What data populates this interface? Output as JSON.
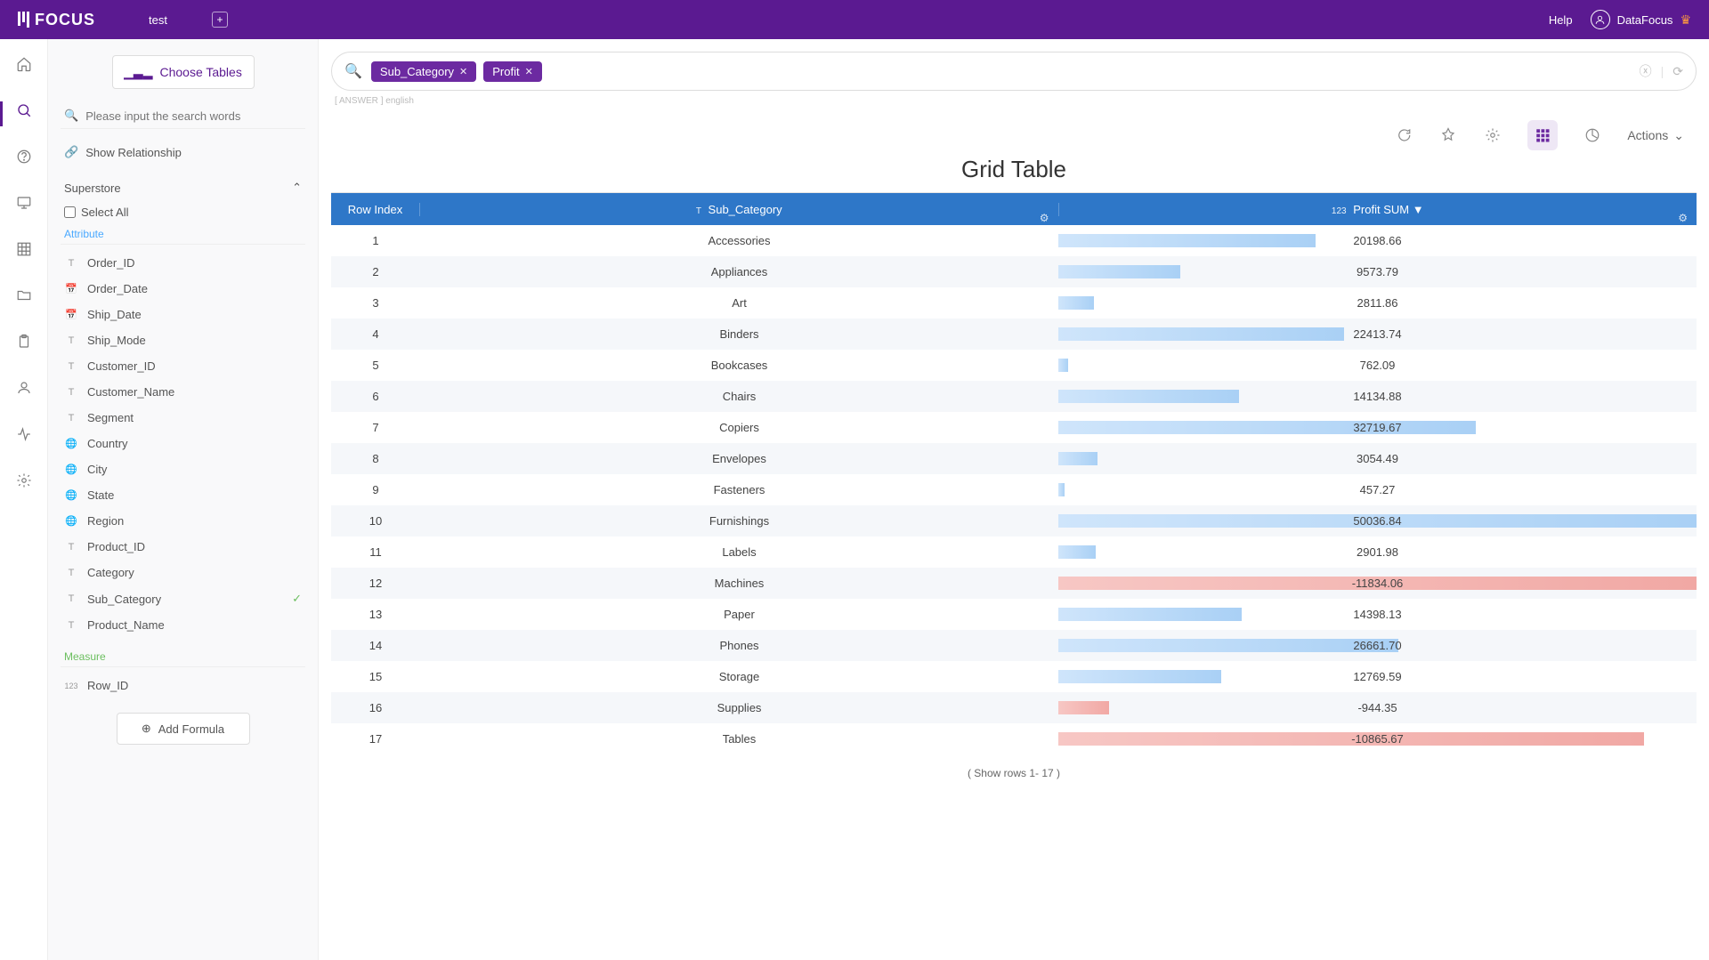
{
  "app": {
    "name": "FOCUS",
    "tab": "test"
  },
  "header": {
    "help": "Help",
    "user": "DataFocus"
  },
  "side": {
    "choose_tables": "Choose Tables",
    "search_placeholder": "Please input the search words",
    "show_relationship": "Show Relationship",
    "datasource": "Superstore",
    "select_all": "Select All",
    "attribute_label": "Attribute",
    "measure_label": "Measure",
    "add_formula": "Add Formula",
    "attributes": [
      {
        "type": "T",
        "name": "Order_ID"
      },
      {
        "type": "D",
        "name": "Order_Date"
      },
      {
        "type": "D",
        "name": "Ship_Date"
      },
      {
        "type": "T",
        "name": "Ship_Mode"
      },
      {
        "type": "T",
        "name": "Customer_ID"
      },
      {
        "type": "T",
        "name": "Customer_Name"
      },
      {
        "type": "T",
        "name": "Segment"
      },
      {
        "type": "G",
        "name": "Country"
      },
      {
        "type": "G",
        "name": "City"
      },
      {
        "type": "G",
        "name": "State"
      },
      {
        "type": "G",
        "name": "Region"
      },
      {
        "type": "T",
        "name": "Product_ID"
      },
      {
        "type": "T",
        "name": "Category"
      },
      {
        "type": "T",
        "name": "Sub_Category",
        "checked": true
      },
      {
        "type": "T",
        "name": "Product_Name"
      }
    ],
    "measures": [
      {
        "type": "123",
        "name": "Row_ID"
      }
    ]
  },
  "search": {
    "pills": [
      "Sub_Category",
      "Profit"
    ],
    "crumb_left": "ANSWER",
    "crumb_right": "english"
  },
  "toolbar": {
    "actions": "Actions"
  },
  "grid": {
    "title": "Grid Table",
    "col_rowidx": "Row Index",
    "col_sub": "Sub_Category",
    "col_profit": "Profit SUM",
    "footer": "( Show rows 1- 17 )",
    "rows": [
      {
        "idx": 1,
        "sub": "Accessories",
        "val": 20198.66
      },
      {
        "idx": 2,
        "sub": "Appliances",
        "val": 9573.79
      },
      {
        "idx": 3,
        "sub": "Art",
        "val": 2811.86
      },
      {
        "idx": 4,
        "sub": "Binders",
        "val": 22413.74
      },
      {
        "idx": 5,
        "sub": "Bookcases",
        "val": 762.09
      },
      {
        "idx": 6,
        "sub": "Chairs",
        "val": 14134.88
      },
      {
        "idx": 7,
        "sub": "Copiers",
        "val": 32719.67
      },
      {
        "idx": 8,
        "sub": "Envelopes",
        "val": 3054.49
      },
      {
        "idx": 9,
        "sub": "Fasteners",
        "val": 457.27
      },
      {
        "idx": 10,
        "sub": "Furnishings",
        "val": 50036.84
      },
      {
        "idx": 11,
        "sub": "Labels",
        "val": 2901.98
      },
      {
        "idx": 12,
        "sub": "Machines",
        "val": -11834.06
      },
      {
        "idx": 13,
        "sub": "Paper",
        "val": 14398.13
      },
      {
        "idx": 14,
        "sub": "Phones",
        "val": 26661.7
      },
      {
        "idx": 15,
        "sub": "Storage",
        "val": 12769.59
      },
      {
        "idx": 16,
        "sub": "Supplies",
        "val": -944.35
      },
      {
        "idx": 17,
        "sub": "Tables",
        "val": -10865.67
      }
    ]
  },
  "chart_data": {
    "type": "table",
    "title": "Grid Table",
    "columns": [
      "Row Index",
      "Sub_Category",
      "Profit SUM"
    ],
    "rows": [
      [
        1,
        "Accessories",
        20198.66
      ],
      [
        2,
        "Appliances",
        9573.79
      ],
      [
        3,
        "Art",
        2811.86
      ],
      [
        4,
        "Binders",
        22413.74
      ],
      [
        5,
        "Bookcases",
        762.09
      ],
      [
        6,
        "Chairs",
        14134.88
      ],
      [
        7,
        "Copiers",
        32719.67
      ],
      [
        8,
        "Envelopes",
        3054.49
      ],
      [
        9,
        "Fasteners",
        457.27
      ],
      [
        10,
        "Furnishings",
        50036.84
      ],
      [
        11,
        "Labels",
        2901.98
      ],
      [
        12,
        "Machines",
        -11834.06
      ],
      [
        13,
        "Paper",
        14398.13
      ],
      [
        14,
        "Phones",
        26661.7
      ],
      [
        15,
        "Storage",
        12769.59
      ],
      [
        16,
        "Supplies",
        -944.35
      ],
      [
        17,
        "Tables",
        -10865.67
      ]
    ]
  }
}
